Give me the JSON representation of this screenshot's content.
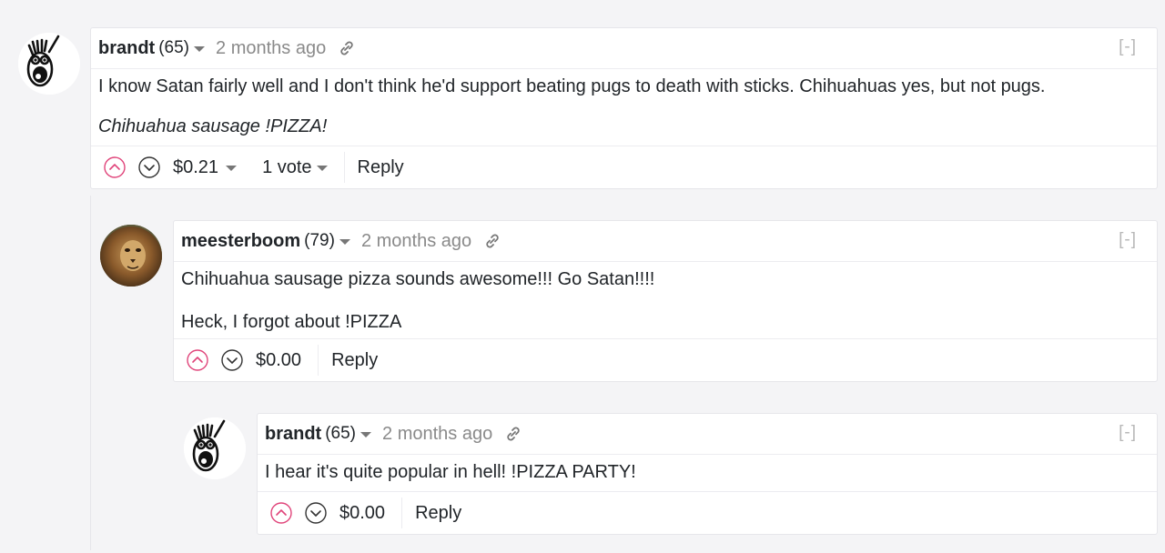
{
  "comments": [
    {
      "author": "brandt",
      "reputation": "(65)",
      "time": "2 months ago",
      "collapse": "[-]",
      "paragraphs": [
        "I know Satan fairly well and I don't think he'd support beating pugs to death with sticks. Chihuahuas yes, but not pugs.",
        "Chihuahua sausage !PIZZA!"
      ],
      "payout": "$0.21",
      "votes": "1 vote",
      "reply": "Reply"
    },
    {
      "author": "meesterboom",
      "reputation": "(79)",
      "time": "2 months ago",
      "collapse": "[-]",
      "paragraphs": [
        "Chihuahua sausage pizza sounds awesome!!! Go Satan!!!!",
        "Heck, I forgot about !PIZZA"
      ],
      "payout": "$0.00",
      "reply": "Reply"
    },
    {
      "author": "brandt",
      "reputation": "(65)",
      "time": "2 months ago",
      "collapse": "[-]",
      "paragraphs": [
        "I hear it's quite popular in hell! !PIZZA PARTY!"
      ],
      "payout": "$0.00",
      "reply": "Reply"
    }
  ],
  "colors": {
    "upvote": "#e0447a",
    "downvote": "#333333",
    "muted": "#8a8a8a"
  },
  "icons": {
    "avatar_1": "cartoon-face-avatar",
    "avatar_2": "lion-photo-avatar",
    "link": "link-icon",
    "upvote": "chevron-up-circle-icon",
    "downvote": "chevron-down-circle-icon"
  }
}
